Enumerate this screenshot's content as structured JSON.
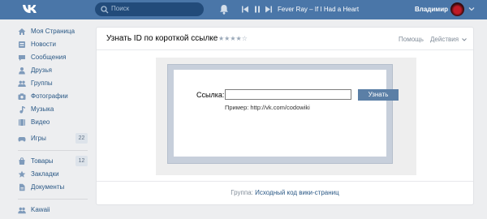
{
  "header": {
    "search_placeholder": "Поиск",
    "now_playing": "Fever Ray – If I Had a Heart",
    "user_name": "Владимир",
    "colors": {
      "bar": "#4a76a8",
      "search_bg": "#224b7a"
    },
    "icons": [
      "vk-logo-icon",
      "search-icon",
      "bell-icon",
      "previous-track-icon",
      "pause-icon",
      "next-track-icon",
      "chevron-down-icon"
    ]
  },
  "sidebar": {
    "items": [
      {
        "label": "Моя Страница",
        "icon": "home-icon"
      },
      {
        "label": "Новости",
        "icon": "news-icon"
      },
      {
        "label": "Сообщения",
        "icon": "messages-icon"
      },
      {
        "label": "Друзья",
        "icon": "friends-icon"
      },
      {
        "label": "Группы",
        "icon": "groups-icon"
      },
      {
        "label": "Фотографии",
        "icon": "photos-icon"
      },
      {
        "label": "Музыка",
        "icon": "music-icon"
      },
      {
        "label": "Видео",
        "icon": "video-icon"
      },
      {
        "label": "Игры",
        "icon": "games-icon",
        "badge": "22"
      }
    ],
    "items2": [
      {
        "label": "Товары",
        "icon": "goods-icon",
        "badge": "12"
      },
      {
        "label": "Закладки",
        "icon": "bookmarks-icon"
      },
      {
        "label": "Документы",
        "icon": "documents-icon"
      }
    ],
    "items3": [
      {
        "label": "Kawaii",
        "icon": "kawaii-icon"
      }
    ]
  },
  "app": {
    "title": "Узнать ID по короткой ссылке",
    "rating_stars": "★★★★☆",
    "rating": 4,
    "help": "Помощь",
    "actions": "Действия",
    "link_label": "Ссылка:",
    "link_value": "",
    "submit": "Узнать",
    "example": "Пример: http://vk.com/codowiki",
    "footer_prefix": "Группа:",
    "footer_link": "Исходный код вики-страниц"
  }
}
